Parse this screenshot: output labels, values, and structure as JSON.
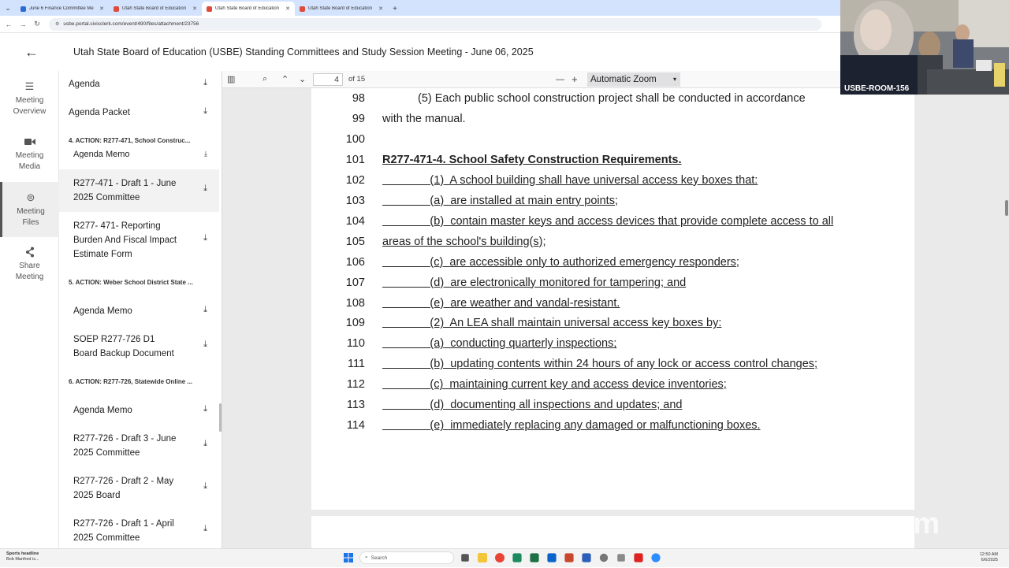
{
  "browser": {
    "tabs": [
      {
        "title": "June 6 Finance Committee Me",
        "active": false
      },
      {
        "title": "Utah State Board of Education",
        "active": false
      },
      {
        "title": "Utah State Board of Education",
        "active": true
      },
      {
        "title": "Utah State Board of Education",
        "active": false
      }
    ],
    "url": "usbe.portal.civicclerk.com/event/490/files/attachment/23756"
  },
  "header": {
    "title": "Utah State Board of Education (USBE) Standing Committees and Study Session Meeting - June 06, 2025"
  },
  "rail": [
    {
      "label_1": "Meeting",
      "label_2": "Overview",
      "icon": "list-icon"
    },
    {
      "label_1": "Meeting",
      "label_2": "Media",
      "icon": "video-icon"
    },
    {
      "label_1": "Meeting",
      "label_2": "Files",
      "icon": "files-icon",
      "active": true
    },
    {
      "label_1": "Share",
      "label_2": "Meeting",
      "icon": "share-icon"
    }
  ],
  "files": {
    "top": [
      "Agenda",
      "Agenda Packet"
    ],
    "sections": [
      "4. ACTION: R277-471, School Construc...",
      "5. ACTION: Weber School District State ...",
      "6. ACTION: R277-726, Statewide Online ..."
    ],
    "sec4_items": [
      {
        "l1": "Agenda Memo",
        "l2": "",
        "l3": ""
      },
      {
        "l1": "R277-471 - Draft 1 - June",
        "l2": "2025 Committee",
        "l3": ""
      },
      {
        "l1": "R277- 471- Reporting",
        "l2": "Burden And Fiscal Impact",
        "l3": "Estimate Form"
      }
    ],
    "sec5_items": [
      {
        "l1": "Agenda Memo",
        "l2": ""
      },
      {
        "l1": "SOEP R277-726 D1",
        "l2": "Board Backup Document"
      }
    ],
    "sec6_items": [
      {
        "l1": "Agenda Memo",
        "l2": ""
      },
      {
        "l1": "R277-726 - Draft 3 - June",
        "l2": "2025 Committee"
      },
      {
        "l1": "R277-726 - Draft 2 - May",
        "l2": "2025 Board"
      },
      {
        "l1": "R277-726 - Draft 1 - April",
        "l2": "2025 Committee"
      }
    ]
  },
  "pdf_toolbar": {
    "page": "4",
    "of_pages": "of 15",
    "zoom": "Automatic Zoom"
  },
  "document": {
    "lines": [
      {
        "n": "98",
        "text": "(5)  Each public school construction project shall be conducted in accordance",
        "style": "indent"
      },
      {
        "n": "99",
        "text": "with the manual.",
        "style": "plain"
      },
      {
        "n": "100",
        "text": "",
        "style": "plain"
      },
      {
        "n": "101",
        "text": "R277-471-4.  School Safety Construction Requirements.",
        "style": "bold"
      },
      {
        "n": "102",
        "text": "(1)  A school building shall have universal access key boxes that:",
        "style": "u-indent"
      },
      {
        "n": "103",
        "text": "(a)  are installed at main entry points;",
        "style": "u-indent"
      },
      {
        "n": "104",
        "text": "(b)  contain master keys and access devices that provide complete access to all",
        "style": "u-indent"
      },
      {
        "n": "105",
        "text": "areas of the school's building(s);",
        "style": "u"
      },
      {
        "n": "106",
        "text": "(c)  are accessible only to authorized emergency responders;",
        "style": "u-indent"
      },
      {
        "n": "107",
        "text": "(d)  are electronically monitored for tampering; and",
        "style": "u-indent"
      },
      {
        "n": "108",
        "text": "(e)  are weather and vandal-resistant.",
        "style": "u-indent"
      },
      {
        "n": "109",
        "text": "(2)  An LEA shall maintain universal access key boxes by:",
        "style": "u-indent"
      },
      {
        "n": "110",
        "text": "(a)  conducting quarterly inspections;",
        "style": "u-indent"
      },
      {
        "n": "111",
        "text": "(b)  updating contents within 24 hours of any lock or access control changes;",
        "style": "u-indent"
      },
      {
        "n": "112",
        "text": "(c)  maintaining current key and access device inventories;",
        "style": "u-indent"
      },
      {
        "n": "113",
        "text": "(d)  documenting all inspections and updates; and",
        "style": "u-indent"
      },
      {
        "n": "114",
        "text": "(e)  immediately replacing any damaged or malfunctioning boxes.",
        "style": "u-indent"
      }
    ]
  },
  "video": {
    "label": "USBE-ROOM-156"
  },
  "watermark": "zoom",
  "taskbar": {
    "widget_title": "Sports headline",
    "widget_sub": "Bob Manfred is...",
    "search": "Search",
    "time": "12:50 AM",
    "date": "6/6/2025"
  }
}
